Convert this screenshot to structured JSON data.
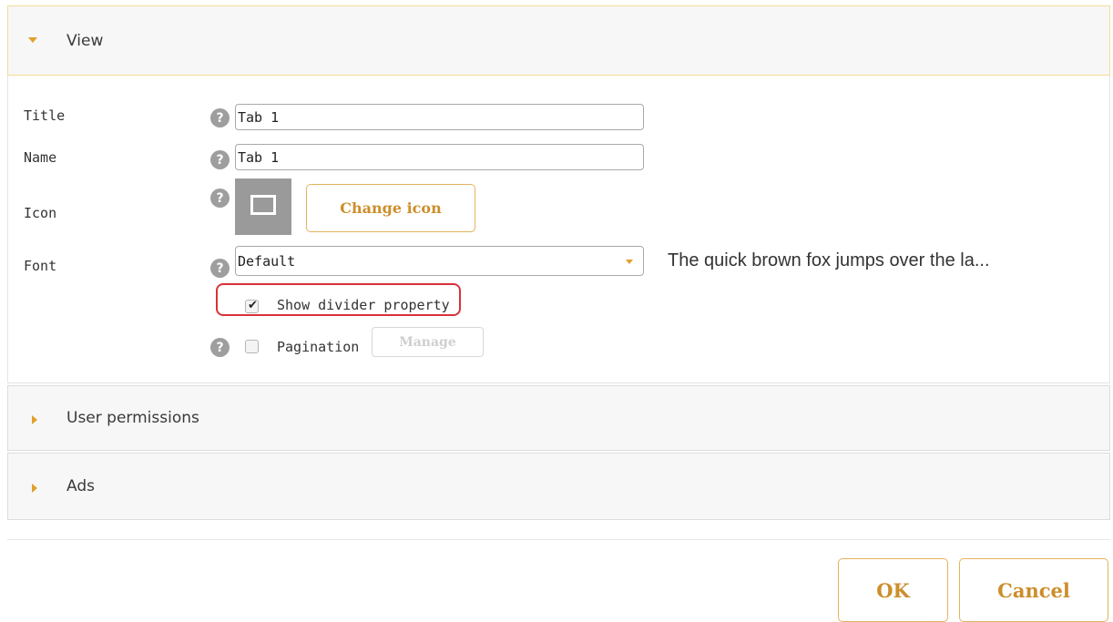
{
  "sections": {
    "view": {
      "label": "View",
      "expanded": true
    },
    "user_permissions": {
      "label": "User permissions",
      "expanded": false
    },
    "ads": {
      "label": "Ads",
      "expanded": false
    }
  },
  "form": {
    "help_glyph": "?",
    "title": {
      "label": "Title",
      "value": "Tab 1"
    },
    "name": {
      "label": "Name",
      "value": "Tab 1"
    },
    "icon": {
      "label": "Icon",
      "icon_name": "folder-icon",
      "change_label": "Change icon"
    },
    "font": {
      "label": "Font",
      "selected": "Default",
      "preview_text": "The quick brown fox jumps over the la..."
    },
    "show_divider": {
      "label": "Show divider property",
      "checked": true,
      "checkmark": "✔"
    },
    "pagination": {
      "label": "Pagination",
      "checked": false,
      "manage_label": "Manage"
    }
  },
  "footer": {
    "ok_label": "OK",
    "cancel_label": "Cancel"
  },
  "colors": {
    "accent": "#e0a02a",
    "button_text": "#cc8e2b",
    "highlight": "#d9313a",
    "header_bg": "#f7f7f7"
  }
}
